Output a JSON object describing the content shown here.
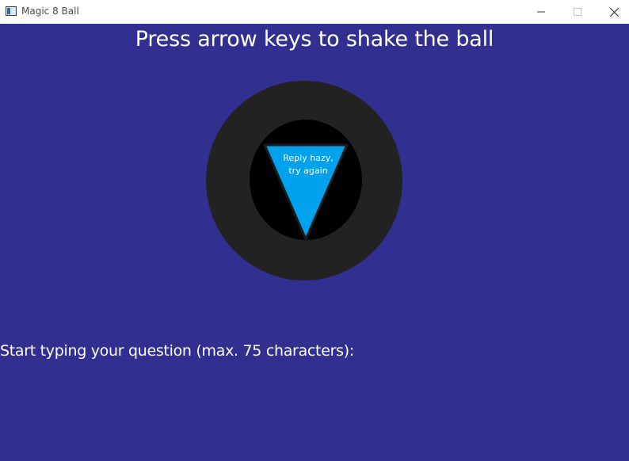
{
  "window": {
    "title": "Magic 8 Ball",
    "controls": {
      "minimize_icon": "minimize-icon",
      "maximize_icon": "maximize-icon",
      "close_icon": "close-icon"
    }
  },
  "game": {
    "instruction": "Press arrow keys to shake the ball",
    "answer": "Reply hazy, try again",
    "prompt": "Start typing your question (max. 75 characters):",
    "question_value": ""
  },
  "colors": {
    "background": "#312f8f",
    "ball_outer": "#222222",
    "ball_window": "#000000",
    "triangle": "#00a2ed",
    "text": "#ffffff"
  }
}
